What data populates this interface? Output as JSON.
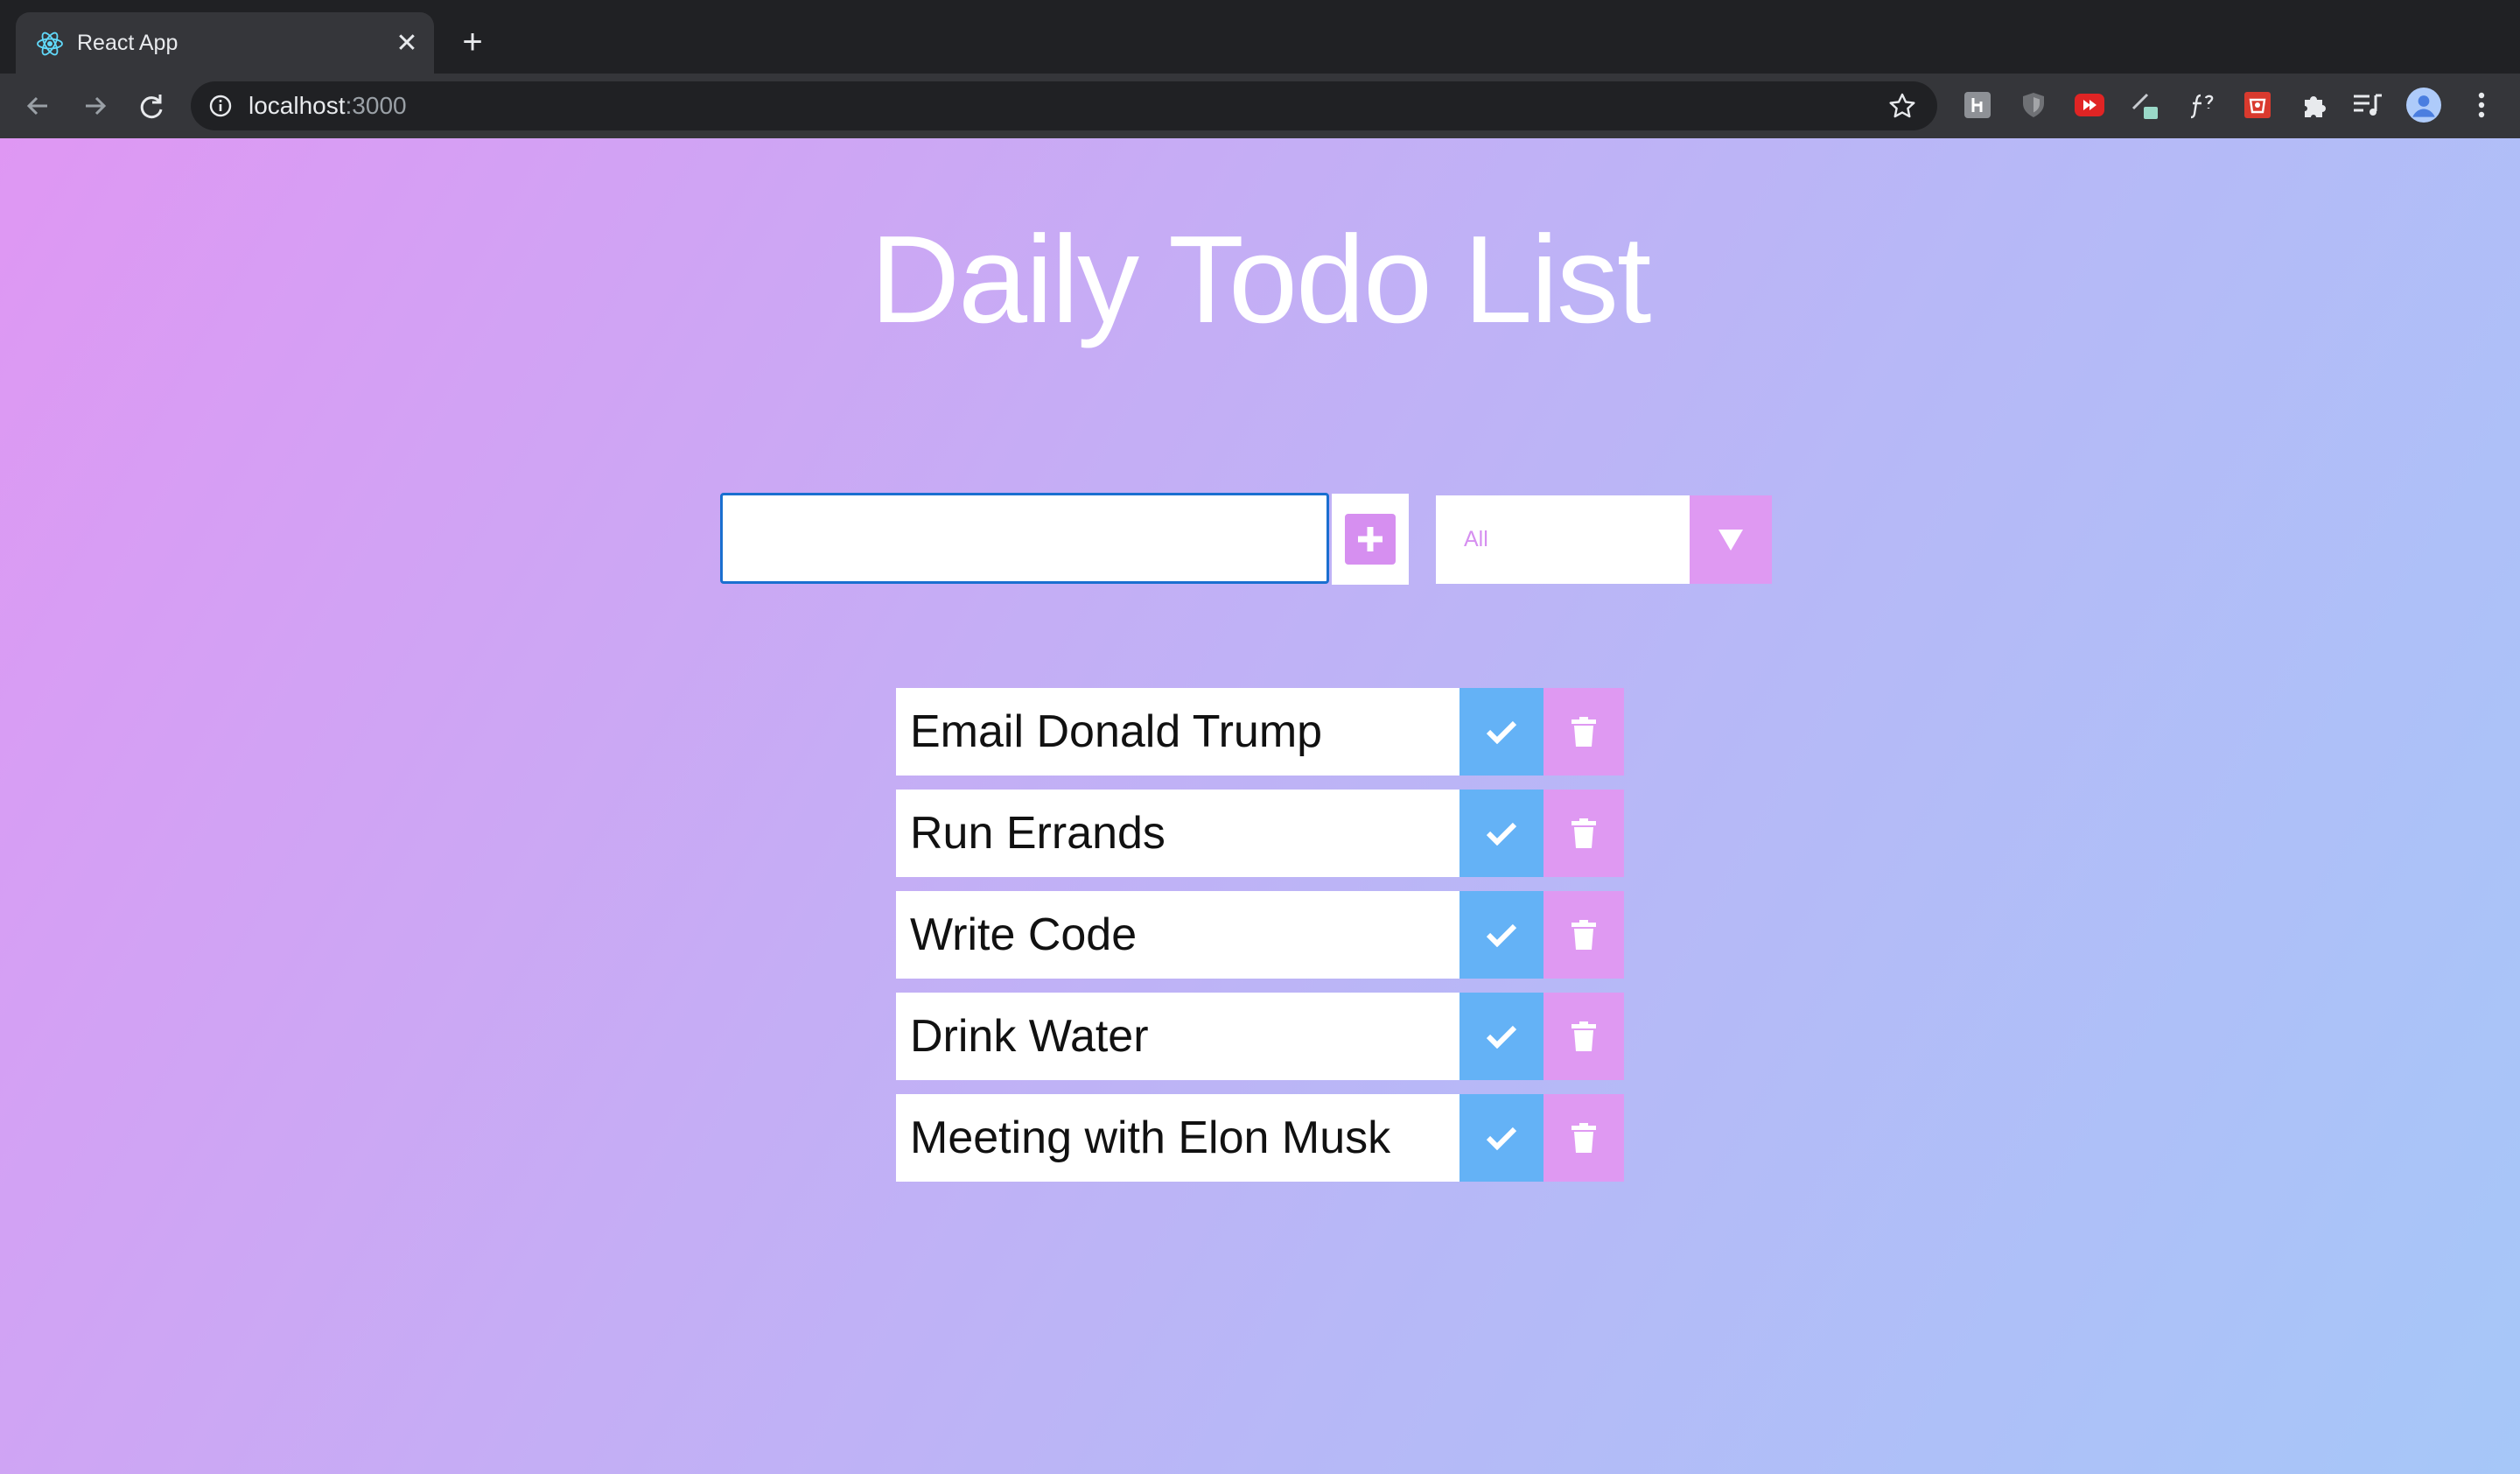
{
  "browser": {
    "tab_title": "React App",
    "close_glyph": "✕",
    "newtab_glyph": "+",
    "url_host": "localhost",
    "url_port": ":3000"
  },
  "app": {
    "title": "Daily Todo List",
    "input_value": "",
    "filter": {
      "selected": "All"
    },
    "todos": [
      {
        "text": "Email Donald Trump"
      },
      {
        "text": "Run Errands"
      },
      {
        "text": "Write Code"
      },
      {
        "text": "Drink Water"
      },
      {
        "text": "Meeting with Elon Musk"
      }
    ]
  },
  "colors": {
    "accent_pink": "#df99f2",
    "complete_blue": "#64b2f6",
    "gradient_start": "#df97f3",
    "gradient_end": "#a6c7f8"
  },
  "icons": {
    "tab": "react-icon",
    "add": "plus-square-icon",
    "filter": "triangle-down-icon",
    "complete": "check-icon",
    "delete": "trash-icon"
  }
}
